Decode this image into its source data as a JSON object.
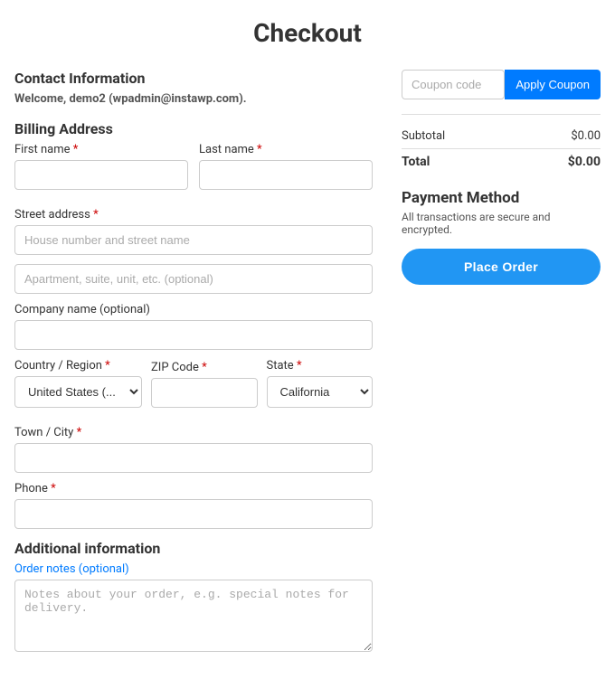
{
  "page": {
    "title": "Checkout"
  },
  "contact": {
    "section_title": "Contact Information",
    "welcome_text": "Welcome,",
    "username": "demo2",
    "email": "(wpadmin@instawp.com)."
  },
  "billing": {
    "section_title": "Billing Address",
    "first_name_label": "First name",
    "last_name_label": "Last name",
    "street_address_label": "Street address",
    "street_placeholder": "House number and street name",
    "apt_placeholder": "Apartment, suite, unit, etc. (optional)",
    "company_label": "Company name (optional)",
    "country_label": "Country / Region",
    "country_value": "United States (...",
    "zip_label": "ZIP Code",
    "state_label": "State",
    "state_value": "California",
    "town_label": "Town / City",
    "phone_label": "Phone"
  },
  "additional": {
    "section_title": "Additional information",
    "notes_label": "Order notes (optional)",
    "notes_placeholder": "Notes about your order, e.g. special notes for delivery."
  },
  "coupon": {
    "placeholder": "Coupon code",
    "button_label": "Apply Coupon"
  },
  "order_summary": {
    "subtotal_label": "Subtotal",
    "subtotal_value": "$0.00",
    "total_label": "Total",
    "total_value": "$0.00"
  },
  "payment": {
    "section_title": "Payment Method",
    "description": "All transactions are secure and encrypted.",
    "place_order_label": "Place Order"
  }
}
